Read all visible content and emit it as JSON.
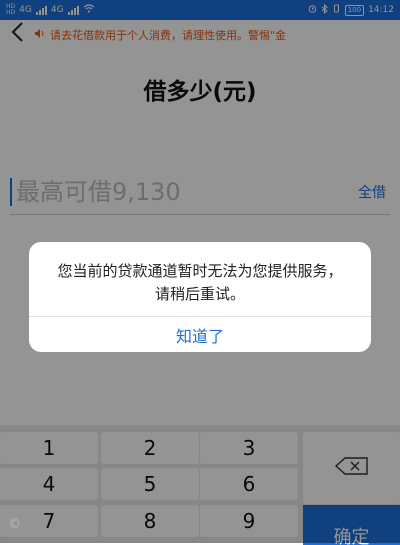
{
  "status_bar": {
    "sim1": "HD",
    "sim2": "HD",
    "net1": "4G",
    "net2": "4G",
    "battery": "100",
    "time": "14:12"
  },
  "header": {
    "back_icon": "chevron-left-icon",
    "notice_icon": "speaker-icon",
    "notice": "请去花借款用于个人消费，请理性使用。警惕\"金"
  },
  "page": {
    "title": "借多少(元)"
  },
  "amount": {
    "placeholder": "最高可借9,130",
    "all_label": "全借"
  },
  "dialog": {
    "message": "您当前的贷款通道暂时无法为您提供服务，请稍后重试。",
    "button": "知道了"
  },
  "keyboard": {
    "keys": [
      "1",
      "2",
      "3",
      "4",
      "5",
      "6",
      "7",
      "8",
      "9"
    ],
    "delete_icon": "backspace-icon",
    "confirm_label": "确定"
  },
  "footer": {
    "copyright": "©"
  },
  "colors": {
    "accent": "#1e6fd9",
    "notice": "#e8570c"
  }
}
